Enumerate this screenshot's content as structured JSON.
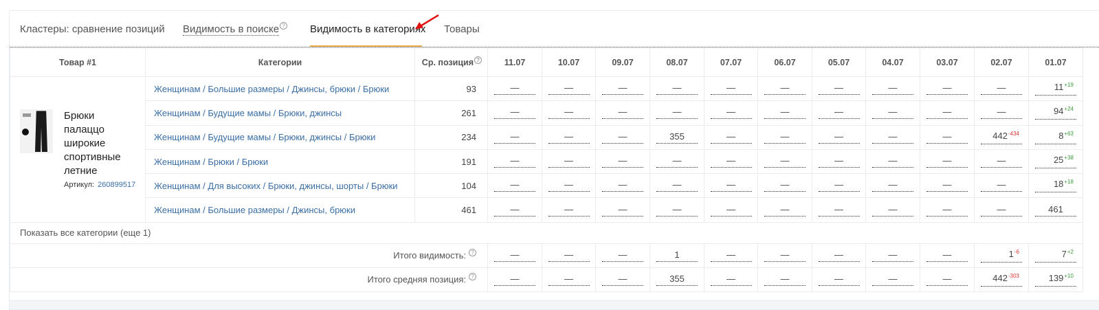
{
  "tabs": [
    {
      "label": "Кластеры: сравнение позиций",
      "active": false,
      "help": false
    },
    {
      "label": "Видимость в поиске",
      "active": false,
      "help": true
    },
    {
      "label": "Видимость в категориях",
      "active": true,
      "help": false
    },
    {
      "label": "Товары",
      "active": false,
      "help": false
    }
  ],
  "accent_color": "#f0ad4e",
  "link_color": "#3a6ea5",
  "table": {
    "headers": {
      "product": "Товар #1",
      "categories": "Категории",
      "avg_position": "Ср. позиция",
      "dates": [
        "11.07",
        "10.07",
        "09.07",
        "08.07",
        "07.07",
        "06.07",
        "05.07",
        "04.07",
        "03.07",
        "02.07",
        "01.07"
      ]
    },
    "product": {
      "name": "Брюки палаццо широкие спортивные летние",
      "sku_label": "Артикул:",
      "sku": "260899517",
      "image_icon": "product-photo-pants"
    },
    "rows": [
      {
        "category": "Женщинам / Большие размеры / Джинсы, брюки / Брюки",
        "avg": "93",
        "cells": [
          {
            "v": "—"
          },
          {
            "v": "—"
          },
          {
            "v": "—"
          },
          {
            "v": "—"
          },
          {
            "v": "—"
          },
          {
            "v": "—"
          },
          {
            "v": "—"
          },
          {
            "v": "—"
          },
          {
            "v": "—"
          },
          {
            "v": "—"
          },
          {
            "v": "11",
            "d": "+19",
            "c": "green"
          }
        ]
      },
      {
        "category": "Женщинам / Будущие мамы / Брюки, джинсы",
        "avg": "261",
        "cells": [
          {
            "v": "—"
          },
          {
            "v": "—"
          },
          {
            "v": "—"
          },
          {
            "v": "—"
          },
          {
            "v": "—"
          },
          {
            "v": "—"
          },
          {
            "v": "—"
          },
          {
            "v": "—"
          },
          {
            "v": "—"
          },
          {
            "v": "—"
          },
          {
            "v": "94",
            "d": "+24",
            "c": "green"
          }
        ]
      },
      {
        "category": "Женщинам / Будущие мамы / Брюки, джинсы / Брюки",
        "avg": "234",
        "cells": [
          {
            "v": "—"
          },
          {
            "v": "—"
          },
          {
            "v": "—"
          },
          {
            "v": "355"
          },
          {
            "v": "—"
          },
          {
            "v": "—"
          },
          {
            "v": "—"
          },
          {
            "v": "—"
          },
          {
            "v": "—"
          },
          {
            "v": "442",
            "d": "-434",
            "c": "red"
          },
          {
            "v": "8",
            "d": "+63",
            "c": "green"
          }
        ]
      },
      {
        "category": "Женщинам / Брюки / Брюки",
        "avg": "191",
        "cells": [
          {
            "v": "—"
          },
          {
            "v": "—"
          },
          {
            "v": "—"
          },
          {
            "v": "—"
          },
          {
            "v": "—"
          },
          {
            "v": "—"
          },
          {
            "v": "—"
          },
          {
            "v": "—"
          },
          {
            "v": "—"
          },
          {
            "v": "—"
          },
          {
            "v": "25",
            "d": "+38",
            "c": "green"
          }
        ]
      },
      {
        "category": "Женщинам / Для высоких / Брюки, джинсы, шорты / Брюки",
        "avg": "104",
        "cells": [
          {
            "v": "—"
          },
          {
            "v": "—"
          },
          {
            "v": "—"
          },
          {
            "v": "—"
          },
          {
            "v": "—"
          },
          {
            "v": "—"
          },
          {
            "v": "—"
          },
          {
            "v": "—"
          },
          {
            "v": "—"
          },
          {
            "v": "—"
          },
          {
            "v": "18",
            "d": "+18",
            "c": "green"
          }
        ]
      },
      {
        "category": "Женщинам / Большие размеры / Джинсы, брюки",
        "avg": "461",
        "cells": [
          {
            "v": "—"
          },
          {
            "v": "—"
          },
          {
            "v": "—"
          },
          {
            "v": "—"
          },
          {
            "v": "—"
          },
          {
            "v": "—"
          },
          {
            "v": "—"
          },
          {
            "v": "—"
          },
          {
            "v": "—"
          },
          {
            "v": "—"
          },
          {
            "v": "461"
          }
        ]
      }
    ],
    "show_more": "Показать все категории (еще 1)",
    "totals": [
      {
        "label": "Итого видимость:",
        "cells": [
          {
            "v": "—"
          },
          {
            "v": "—"
          },
          {
            "v": "—"
          },
          {
            "v": "1"
          },
          {
            "v": "—"
          },
          {
            "v": "—"
          },
          {
            "v": "—"
          },
          {
            "v": "—"
          },
          {
            "v": "—"
          },
          {
            "v": "1",
            "d": "-6",
            "c": "red"
          },
          {
            "v": "7",
            "d": "+2",
            "c": "green"
          }
        ]
      },
      {
        "label": "Итого средняя позиция:",
        "cells": [
          {
            "v": "—"
          },
          {
            "v": "—"
          },
          {
            "v": "—"
          },
          {
            "v": "355"
          },
          {
            "v": "—"
          },
          {
            "v": "—"
          },
          {
            "v": "—"
          },
          {
            "v": "—"
          },
          {
            "v": "—"
          },
          {
            "v": "442",
            "d": "-303",
            "c": "red"
          },
          {
            "v": "139",
            "d": "+10",
            "c": "green"
          }
        ]
      }
    ]
  }
}
